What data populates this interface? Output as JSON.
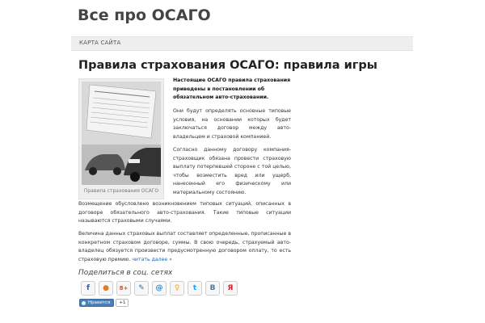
{
  "site": {
    "title": "Все про ОСАГО"
  },
  "nav": {
    "items": [
      {
        "label": "КАРТА САЙТА"
      }
    ]
  },
  "post": {
    "title": "Правила страхования ОСАГО: правила игры",
    "image_caption": "Правила страхования ОСАГО",
    "lead": "Настоящие ОСАГО правила страхования приведены в постановлении об обязательном авто-страховании.",
    "paragraphs": [
      "Они будут определять основные типовые условия, на основании которых будет заключаться договор между авто-владельцем и страховой компанией.",
      "Согласно данному договору компания-страховщик обязана провести страховую выплату потерпевшей стороне с той целью, чтобы возместить вред или ущерб, нанесенный его физическому или материальному состоянию.",
      "Возмещение обусловлено возникновением типовых ситуаций, описанных в договоре обязательного авто-страхования. Такие типовые ситуации называются страховыми случаями.",
      "Величина данных страховых выплат составляет определенные, прописанные в конкретном страховом договоре, суммы. В свою очередь, страхуемый авто-владелец обязуется произвести предусмотренную договором оплату, то есть страховую премию."
    ],
    "read_more": "читать далее »"
  },
  "share": {
    "heading": "Поделиться в соц. сетях",
    "buttons": [
      {
        "icon": "facebook-icon",
        "glyph": "f",
        "color": "#3b5998"
      },
      {
        "icon": "chat-bubbles-icon",
        "glyph": "●",
        "color": "#e07b22"
      },
      {
        "icon": "google-plus-icon",
        "glyph": "8+",
        "color": "#dd4b39"
      },
      {
        "icon": "livejournal-icon",
        "glyph": "✎",
        "color": "#2a6fa5"
      },
      {
        "icon": "mail-at-icon",
        "glyph": "@",
        "color": "#168de2"
      },
      {
        "icon": "odnoklassniki-icon",
        "glyph": "♀",
        "color": "#f2a21c"
      },
      {
        "icon": "twitter-icon",
        "glyph": "t",
        "color": "#1da1f2"
      },
      {
        "icon": "vkontakte-icon",
        "glyph": "В",
        "color": "#4c75a3"
      },
      {
        "icon": "yandex-icon",
        "glyph": "Я",
        "color": "#e8192c"
      }
    ],
    "like": {
      "label": "Нравится",
      "count": "+1"
    }
  }
}
